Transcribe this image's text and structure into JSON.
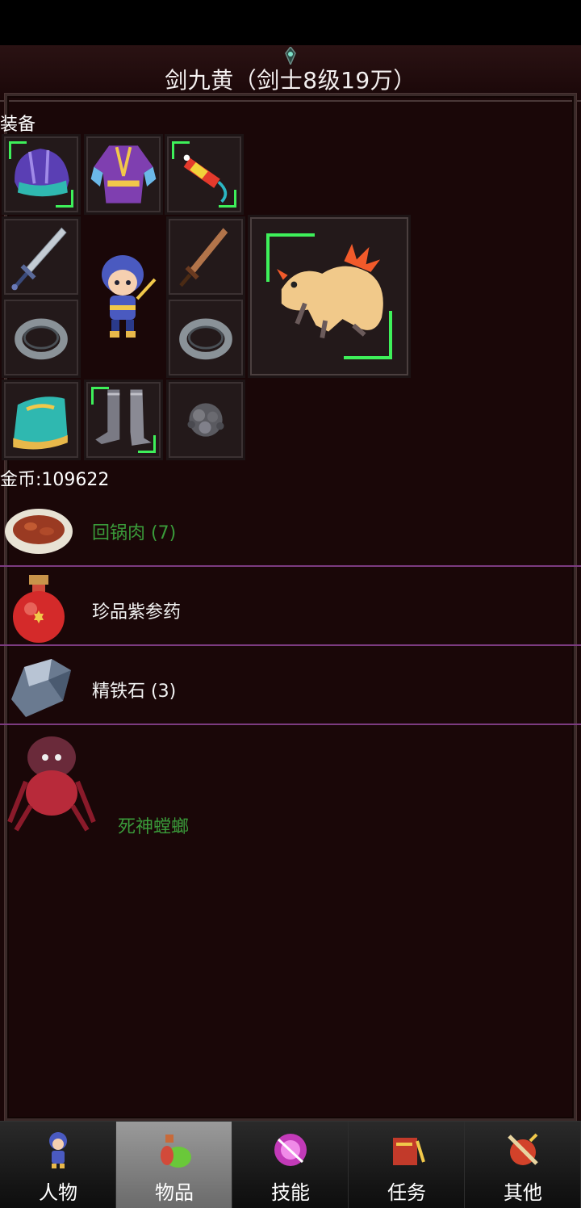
{
  "title": "剑九黄（剑士8级19万）",
  "equipment": {
    "label": "装备",
    "slots": [
      {
        "icon": "helmet-icon",
        "quality": "green"
      },
      {
        "icon": "robe-icon",
        "quality": "normal"
      },
      {
        "icon": "amulet-icon",
        "quality": "green"
      },
      {
        "icon": "sword-icon",
        "quality": "normal"
      },
      {
        "icon": "wooden-sword-icon",
        "quality": "normal"
      },
      {
        "icon": "ring-icon",
        "quality": "normal"
      },
      {
        "icon": "ring-icon",
        "quality": "normal"
      },
      {
        "icon": "bracer-icon",
        "quality": "normal"
      },
      {
        "icon": "boots-icon",
        "quality": "green"
      },
      {
        "icon": "ore-icon",
        "quality": "normal"
      }
    ],
    "pet": {
      "icon": "salamander-pet-icon",
      "quality": "green"
    }
  },
  "gold_text": "金币:109622",
  "inventory": [
    {
      "label": "回锅肉 (7)",
      "color": "#3a9b3a",
      "icon": "meat-dish-icon"
    },
    {
      "label": "珍品紫参药",
      "color": "#f2f2f2",
      "icon": "red-potion-icon"
    },
    {
      "label": "精铁石 (3)",
      "color": "#f2f2f2",
      "icon": "iron-stone-icon"
    },
    {
      "label": "死神螳螂",
      "color": "#3a9b3a",
      "icon": "mantis-icon"
    }
  ],
  "tabs": [
    {
      "label": "人物",
      "icon": "character-icon"
    },
    {
      "label": "物品",
      "icon": "potion-bag-icon",
      "active": true
    },
    {
      "label": "技能",
      "icon": "skill-orb-icon"
    },
    {
      "label": "任务",
      "icon": "quest-icon"
    },
    {
      "label": "其他",
      "icon": "other-icon"
    }
  ],
  "colors": {
    "background": "#1a0708",
    "rare_green": "#3ef05a",
    "divider": "#7c3b80",
    "item_green": "#3a9b3a"
  }
}
